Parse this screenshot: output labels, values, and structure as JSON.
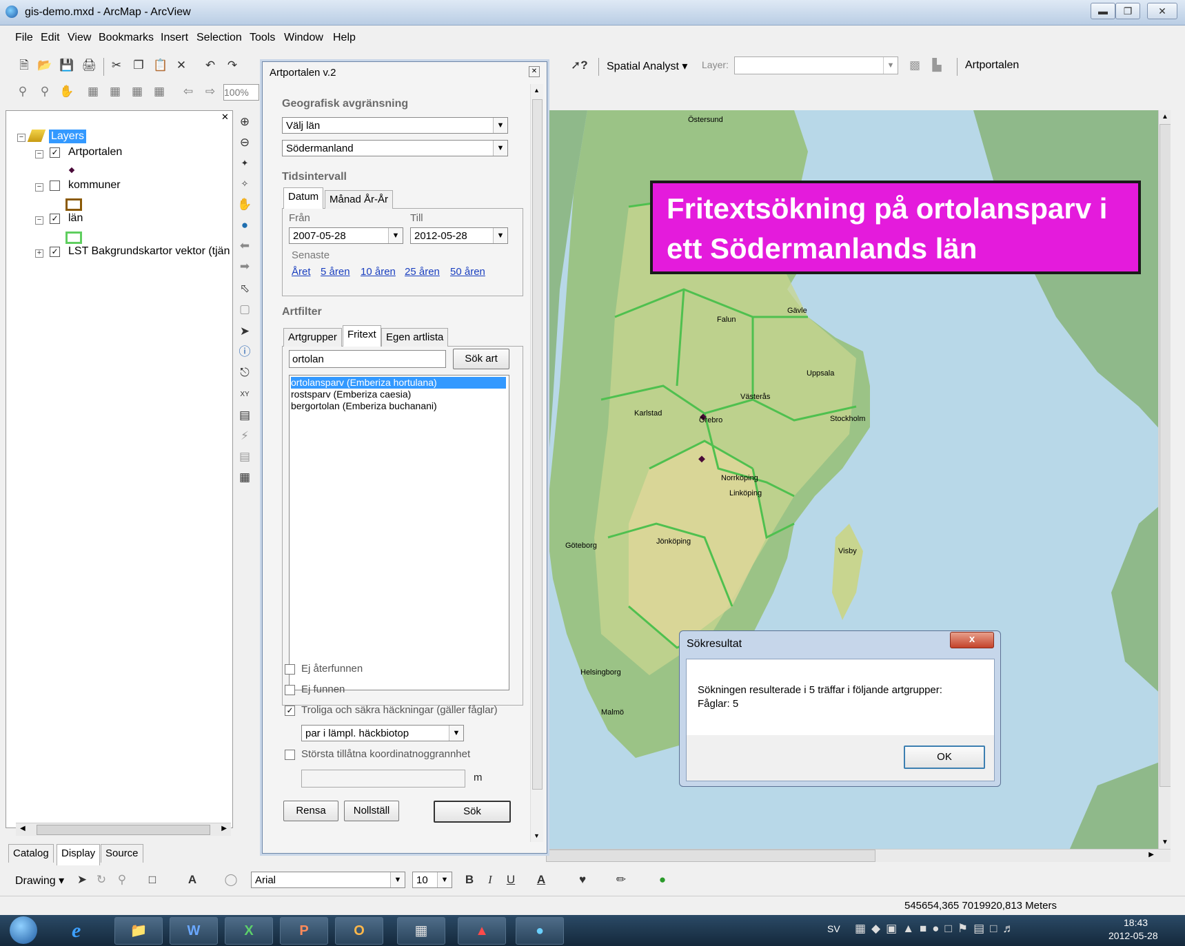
{
  "window": {
    "title": "gis-demo.mxd - ArcMap - ArcView"
  },
  "menu": [
    "File",
    "Edit",
    "View",
    "Bookmarks",
    "Insert",
    "Selection",
    "Tools",
    "Window",
    "Help"
  ],
  "toolbar": {
    "spatial_analyst": "Spatial Analyst",
    "layer_label": "Layer:",
    "artportalen_button": "Artportalen",
    "zoom": "100%"
  },
  "toc": {
    "root": "Layers",
    "layers": [
      {
        "name": "Artportalen",
        "checked": true
      },
      {
        "name": "kommuner",
        "checked": false
      },
      {
        "name": "län",
        "checked": true
      },
      {
        "name": "LST Bakgrundskartor vektor (tjän",
        "checked": true
      }
    ],
    "tabs": [
      "Catalog",
      "Display",
      "Source"
    ]
  },
  "dock": {
    "title": "Artportalen v.2",
    "geo_header": "Geografisk avgränsning",
    "select_type": "Välj län",
    "selected_county": "Södermanland",
    "time_header": "Tidsintervall",
    "time_tabs": [
      "Datum",
      "Månad År-År"
    ],
    "from_label": "Från",
    "to_label": "Till",
    "from_value": "2007-05-28",
    "to_value": "2012-05-28",
    "recent_label": "Senaste",
    "recent_links": [
      "Året",
      "5 åren",
      "10 åren",
      "25 åren",
      "50 åren"
    ],
    "filter_header": "Artfilter",
    "filter_tabs": [
      "Artgrupper",
      "Fritext",
      "Egen artlista"
    ],
    "search_text": "ortolan",
    "search_species_button": "Sök art",
    "species": [
      "ortolansparv (Emberiza hortulana)",
      "rostsparv (Emberiza caesia)",
      "bergortolan (Emberiza buchanani)"
    ],
    "opt_not_refound": "Ej återfunnen",
    "opt_not_found": "Ej funnen",
    "opt_breeding": "Troliga och säkra häckningar (gäller fåglar)",
    "breeding_select": "par i lämpl. häckbiotop",
    "opt_accuracy": "Största tillåtna koordinatnoggrannhet",
    "unit": "m",
    "btn_clear": "Rensa",
    "btn_reset": "Nollställ",
    "btn_search": "Sök"
  },
  "map": {
    "banner": "Fritextsökning på ortolansparv i ett Södermanlands län",
    "cities": [
      "Östersund",
      "Falun",
      "Gävle",
      "Uppsala",
      "Västerås",
      "Karlstad",
      "Örebro",
      "Stockholm",
      "Norrköping",
      "Linköping",
      "Jönköping",
      "Göteborg",
      "Visby",
      "Helsingborg",
      "Malmö"
    ]
  },
  "dialog": {
    "title": "Sökresultat",
    "close": "x",
    "message_line1": "Sökningen resulterade i 5 träffar i följande artgrupper:",
    "message_line2": "Fåglar: 5",
    "ok": "OK"
  },
  "drawing_toolbar": {
    "drawing": "Drawing",
    "font": "Arial",
    "size": "10"
  },
  "status": {
    "coords": "545654,365  7019920,813 Meters"
  },
  "taskbar": {
    "lang": "SV",
    "time": "18:43",
    "date": "2012-05-28"
  }
}
